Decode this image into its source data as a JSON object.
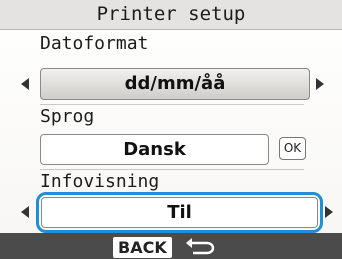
{
  "title": "Printer setup",
  "date_format": {
    "label": "Datoformat",
    "value": "dd/mm/åå"
  },
  "language": {
    "label": "Sprog",
    "value": "Dansk",
    "ok_label": "OK"
  },
  "info_display": {
    "label": "Infovisning",
    "value": "Til"
  },
  "footer": {
    "back_label": "BACK",
    "back_icon": "return-arrow-icon"
  },
  "colors": {
    "selection": "#1f8fd6",
    "footer_bg": "#4b4b4b",
    "title_bg": "#e4e3e1"
  }
}
